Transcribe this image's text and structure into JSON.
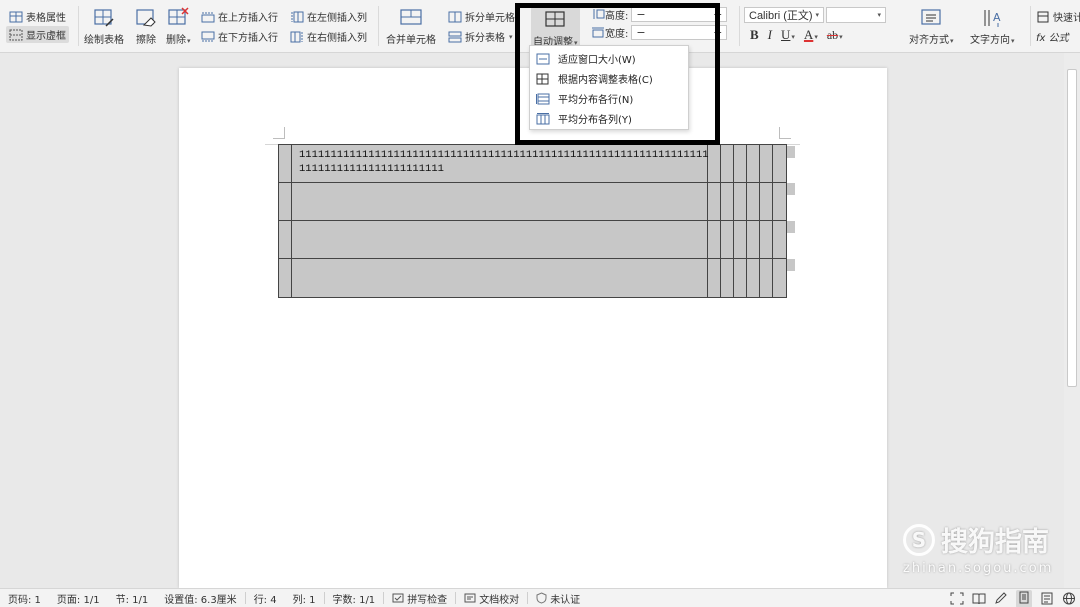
{
  "ribbon": {
    "table_props": "表格属性",
    "show_gridlines": "显示虚框",
    "draw_table": "绘制表格",
    "erase": "擦除",
    "delete": "删除",
    "insert_above": "在上方插入行",
    "insert_below": "在下方插入行",
    "insert_left": "在左侧插入列",
    "insert_right": "在右侧插入列",
    "merge_cells": "合并单元格",
    "split_cells": "拆分单元格",
    "split_table": "拆分表格",
    "auto_fit": "自动调整",
    "height_label": "高度:",
    "width_label": "宽度:",
    "minus": "−",
    "plus": "+",
    "font_name": "Calibri (正文)",
    "font_size": "",
    "bold": "B",
    "italic": "I",
    "underline": "U",
    "font_color": "A",
    "highlight": "ab",
    "align": "对齐方式",
    "text_direction": "文字方向",
    "quick_calc": "快速计",
    "formula": "fx 公式"
  },
  "dropdown": {
    "items": [
      "适应窗口大小(W)",
      "根据内容调整表格(C)",
      "平均分布各行(N)",
      "平均分布各列(Y)"
    ]
  },
  "document": {
    "cell_text": "1111111111111111111111111111111111111111111111111111111111111111111111111111111111111111"
  },
  "watermark": {
    "logo_char": "S",
    "brand": "搜狗指南",
    "url": "zhinan.sogou.com"
  },
  "status": {
    "page_num": "页码: 1",
    "pages": "页面: 1/1",
    "section": "节: 1/1",
    "setting": "设置值: 6.3厘米",
    "row": "行: 4",
    "col": "列: 1",
    "word_count": "字数: 1/1",
    "spell_check": "拼写检查",
    "doc_proof": "文档校对",
    "uncertified": "未认证"
  },
  "colors": {
    "table_fill": "#c7c7c7",
    "ribbon_bg": "#f3f3f3",
    "highlight_box": "#000000"
  }
}
